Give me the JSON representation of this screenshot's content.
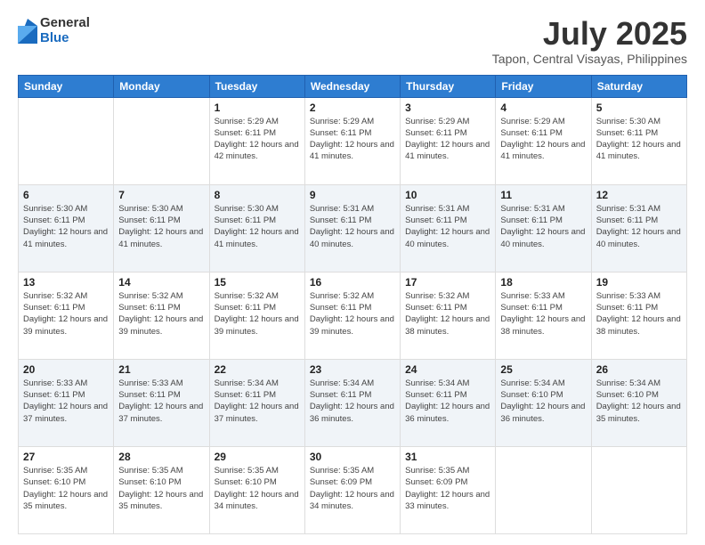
{
  "logo": {
    "general": "General",
    "blue": "Blue"
  },
  "header": {
    "title": "July 2025",
    "subtitle": "Tapon, Central Visayas, Philippines"
  },
  "weekdays": [
    "Sunday",
    "Monday",
    "Tuesday",
    "Wednesday",
    "Thursday",
    "Friday",
    "Saturday"
  ],
  "weeks": [
    [
      {
        "day": "",
        "sunrise": "",
        "sunset": "",
        "daylight": ""
      },
      {
        "day": "",
        "sunrise": "",
        "sunset": "",
        "daylight": ""
      },
      {
        "day": "1",
        "sunrise": "Sunrise: 5:29 AM",
        "sunset": "Sunset: 6:11 PM",
        "daylight": "Daylight: 12 hours and 42 minutes."
      },
      {
        "day": "2",
        "sunrise": "Sunrise: 5:29 AM",
        "sunset": "Sunset: 6:11 PM",
        "daylight": "Daylight: 12 hours and 41 minutes."
      },
      {
        "day": "3",
        "sunrise": "Sunrise: 5:29 AM",
        "sunset": "Sunset: 6:11 PM",
        "daylight": "Daylight: 12 hours and 41 minutes."
      },
      {
        "day": "4",
        "sunrise": "Sunrise: 5:29 AM",
        "sunset": "Sunset: 6:11 PM",
        "daylight": "Daylight: 12 hours and 41 minutes."
      },
      {
        "day": "5",
        "sunrise": "Sunrise: 5:30 AM",
        "sunset": "Sunset: 6:11 PM",
        "daylight": "Daylight: 12 hours and 41 minutes."
      }
    ],
    [
      {
        "day": "6",
        "sunrise": "Sunrise: 5:30 AM",
        "sunset": "Sunset: 6:11 PM",
        "daylight": "Daylight: 12 hours and 41 minutes."
      },
      {
        "day": "7",
        "sunrise": "Sunrise: 5:30 AM",
        "sunset": "Sunset: 6:11 PM",
        "daylight": "Daylight: 12 hours and 41 minutes."
      },
      {
        "day": "8",
        "sunrise": "Sunrise: 5:30 AM",
        "sunset": "Sunset: 6:11 PM",
        "daylight": "Daylight: 12 hours and 41 minutes."
      },
      {
        "day": "9",
        "sunrise": "Sunrise: 5:31 AM",
        "sunset": "Sunset: 6:11 PM",
        "daylight": "Daylight: 12 hours and 40 minutes."
      },
      {
        "day": "10",
        "sunrise": "Sunrise: 5:31 AM",
        "sunset": "Sunset: 6:11 PM",
        "daylight": "Daylight: 12 hours and 40 minutes."
      },
      {
        "day": "11",
        "sunrise": "Sunrise: 5:31 AM",
        "sunset": "Sunset: 6:11 PM",
        "daylight": "Daylight: 12 hours and 40 minutes."
      },
      {
        "day": "12",
        "sunrise": "Sunrise: 5:31 AM",
        "sunset": "Sunset: 6:11 PM",
        "daylight": "Daylight: 12 hours and 40 minutes."
      }
    ],
    [
      {
        "day": "13",
        "sunrise": "Sunrise: 5:32 AM",
        "sunset": "Sunset: 6:11 PM",
        "daylight": "Daylight: 12 hours and 39 minutes."
      },
      {
        "day": "14",
        "sunrise": "Sunrise: 5:32 AM",
        "sunset": "Sunset: 6:11 PM",
        "daylight": "Daylight: 12 hours and 39 minutes."
      },
      {
        "day": "15",
        "sunrise": "Sunrise: 5:32 AM",
        "sunset": "Sunset: 6:11 PM",
        "daylight": "Daylight: 12 hours and 39 minutes."
      },
      {
        "day": "16",
        "sunrise": "Sunrise: 5:32 AM",
        "sunset": "Sunset: 6:11 PM",
        "daylight": "Daylight: 12 hours and 39 minutes."
      },
      {
        "day": "17",
        "sunrise": "Sunrise: 5:32 AM",
        "sunset": "Sunset: 6:11 PM",
        "daylight": "Daylight: 12 hours and 38 minutes."
      },
      {
        "day": "18",
        "sunrise": "Sunrise: 5:33 AM",
        "sunset": "Sunset: 6:11 PM",
        "daylight": "Daylight: 12 hours and 38 minutes."
      },
      {
        "day": "19",
        "sunrise": "Sunrise: 5:33 AM",
        "sunset": "Sunset: 6:11 PM",
        "daylight": "Daylight: 12 hours and 38 minutes."
      }
    ],
    [
      {
        "day": "20",
        "sunrise": "Sunrise: 5:33 AM",
        "sunset": "Sunset: 6:11 PM",
        "daylight": "Daylight: 12 hours and 37 minutes."
      },
      {
        "day": "21",
        "sunrise": "Sunrise: 5:33 AM",
        "sunset": "Sunset: 6:11 PM",
        "daylight": "Daylight: 12 hours and 37 minutes."
      },
      {
        "day": "22",
        "sunrise": "Sunrise: 5:34 AM",
        "sunset": "Sunset: 6:11 PM",
        "daylight": "Daylight: 12 hours and 37 minutes."
      },
      {
        "day": "23",
        "sunrise": "Sunrise: 5:34 AM",
        "sunset": "Sunset: 6:11 PM",
        "daylight": "Daylight: 12 hours and 36 minutes."
      },
      {
        "day": "24",
        "sunrise": "Sunrise: 5:34 AM",
        "sunset": "Sunset: 6:11 PM",
        "daylight": "Daylight: 12 hours and 36 minutes."
      },
      {
        "day": "25",
        "sunrise": "Sunrise: 5:34 AM",
        "sunset": "Sunset: 6:10 PM",
        "daylight": "Daylight: 12 hours and 36 minutes."
      },
      {
        "day": "26",
        "sunrise": "Sunrise: 5:34 AM",
        "sunset": "Sunset: 6:10 PM",
        "daylight": "Daylight: 12 hours and 35 minutes."
      }
    ],
    [
      {
        "day": "27",
        "sunrise": "Sunrise: 5:35 AM",
        "sunset": "Sunset: 6:10 PM",
        "daylight": "Daylight: 12 hours and 35 minutes."
      },
      {
        "day": "28",
        "sunrise": "Sunrise: 5:35 AM",
        "sunset": "Sunset: 6:10 PM",
        "daylight": "Daylight: 12 hours and 35 minutes."
      },
      {
        "day": "29",
        "sunrise": "Sunrise: 5:35 AM",
        "sunset": "Sunset: 6:10 PM",
        "daylight": "Daylight: 12 hours and 34 minutes."
      },
      {
        "day": "30",
        "sunrise": "Sunrise: 5:35 AM",
        "sunset": "Sunset: 6:09 PM",
        "daylight": "Daylight: 12 hours and 34 minutes."
      },
      {
        "day": "31",
        "sunrise": "Sunrise: 5:35 AM",
        "sunset": "Sunset: 6:09 PM",
        "daylight": "Daylight: 12 hours and 33 minutes."
      },
      {
        "day": "",
        "sunrise": "",
        "sunset": "",
        "daylight": ""
      },
      {
        "day": "",
        "sunrise": "",
        "sunset": "",
        "daylight": ""
      }
    ]
  ]
}
